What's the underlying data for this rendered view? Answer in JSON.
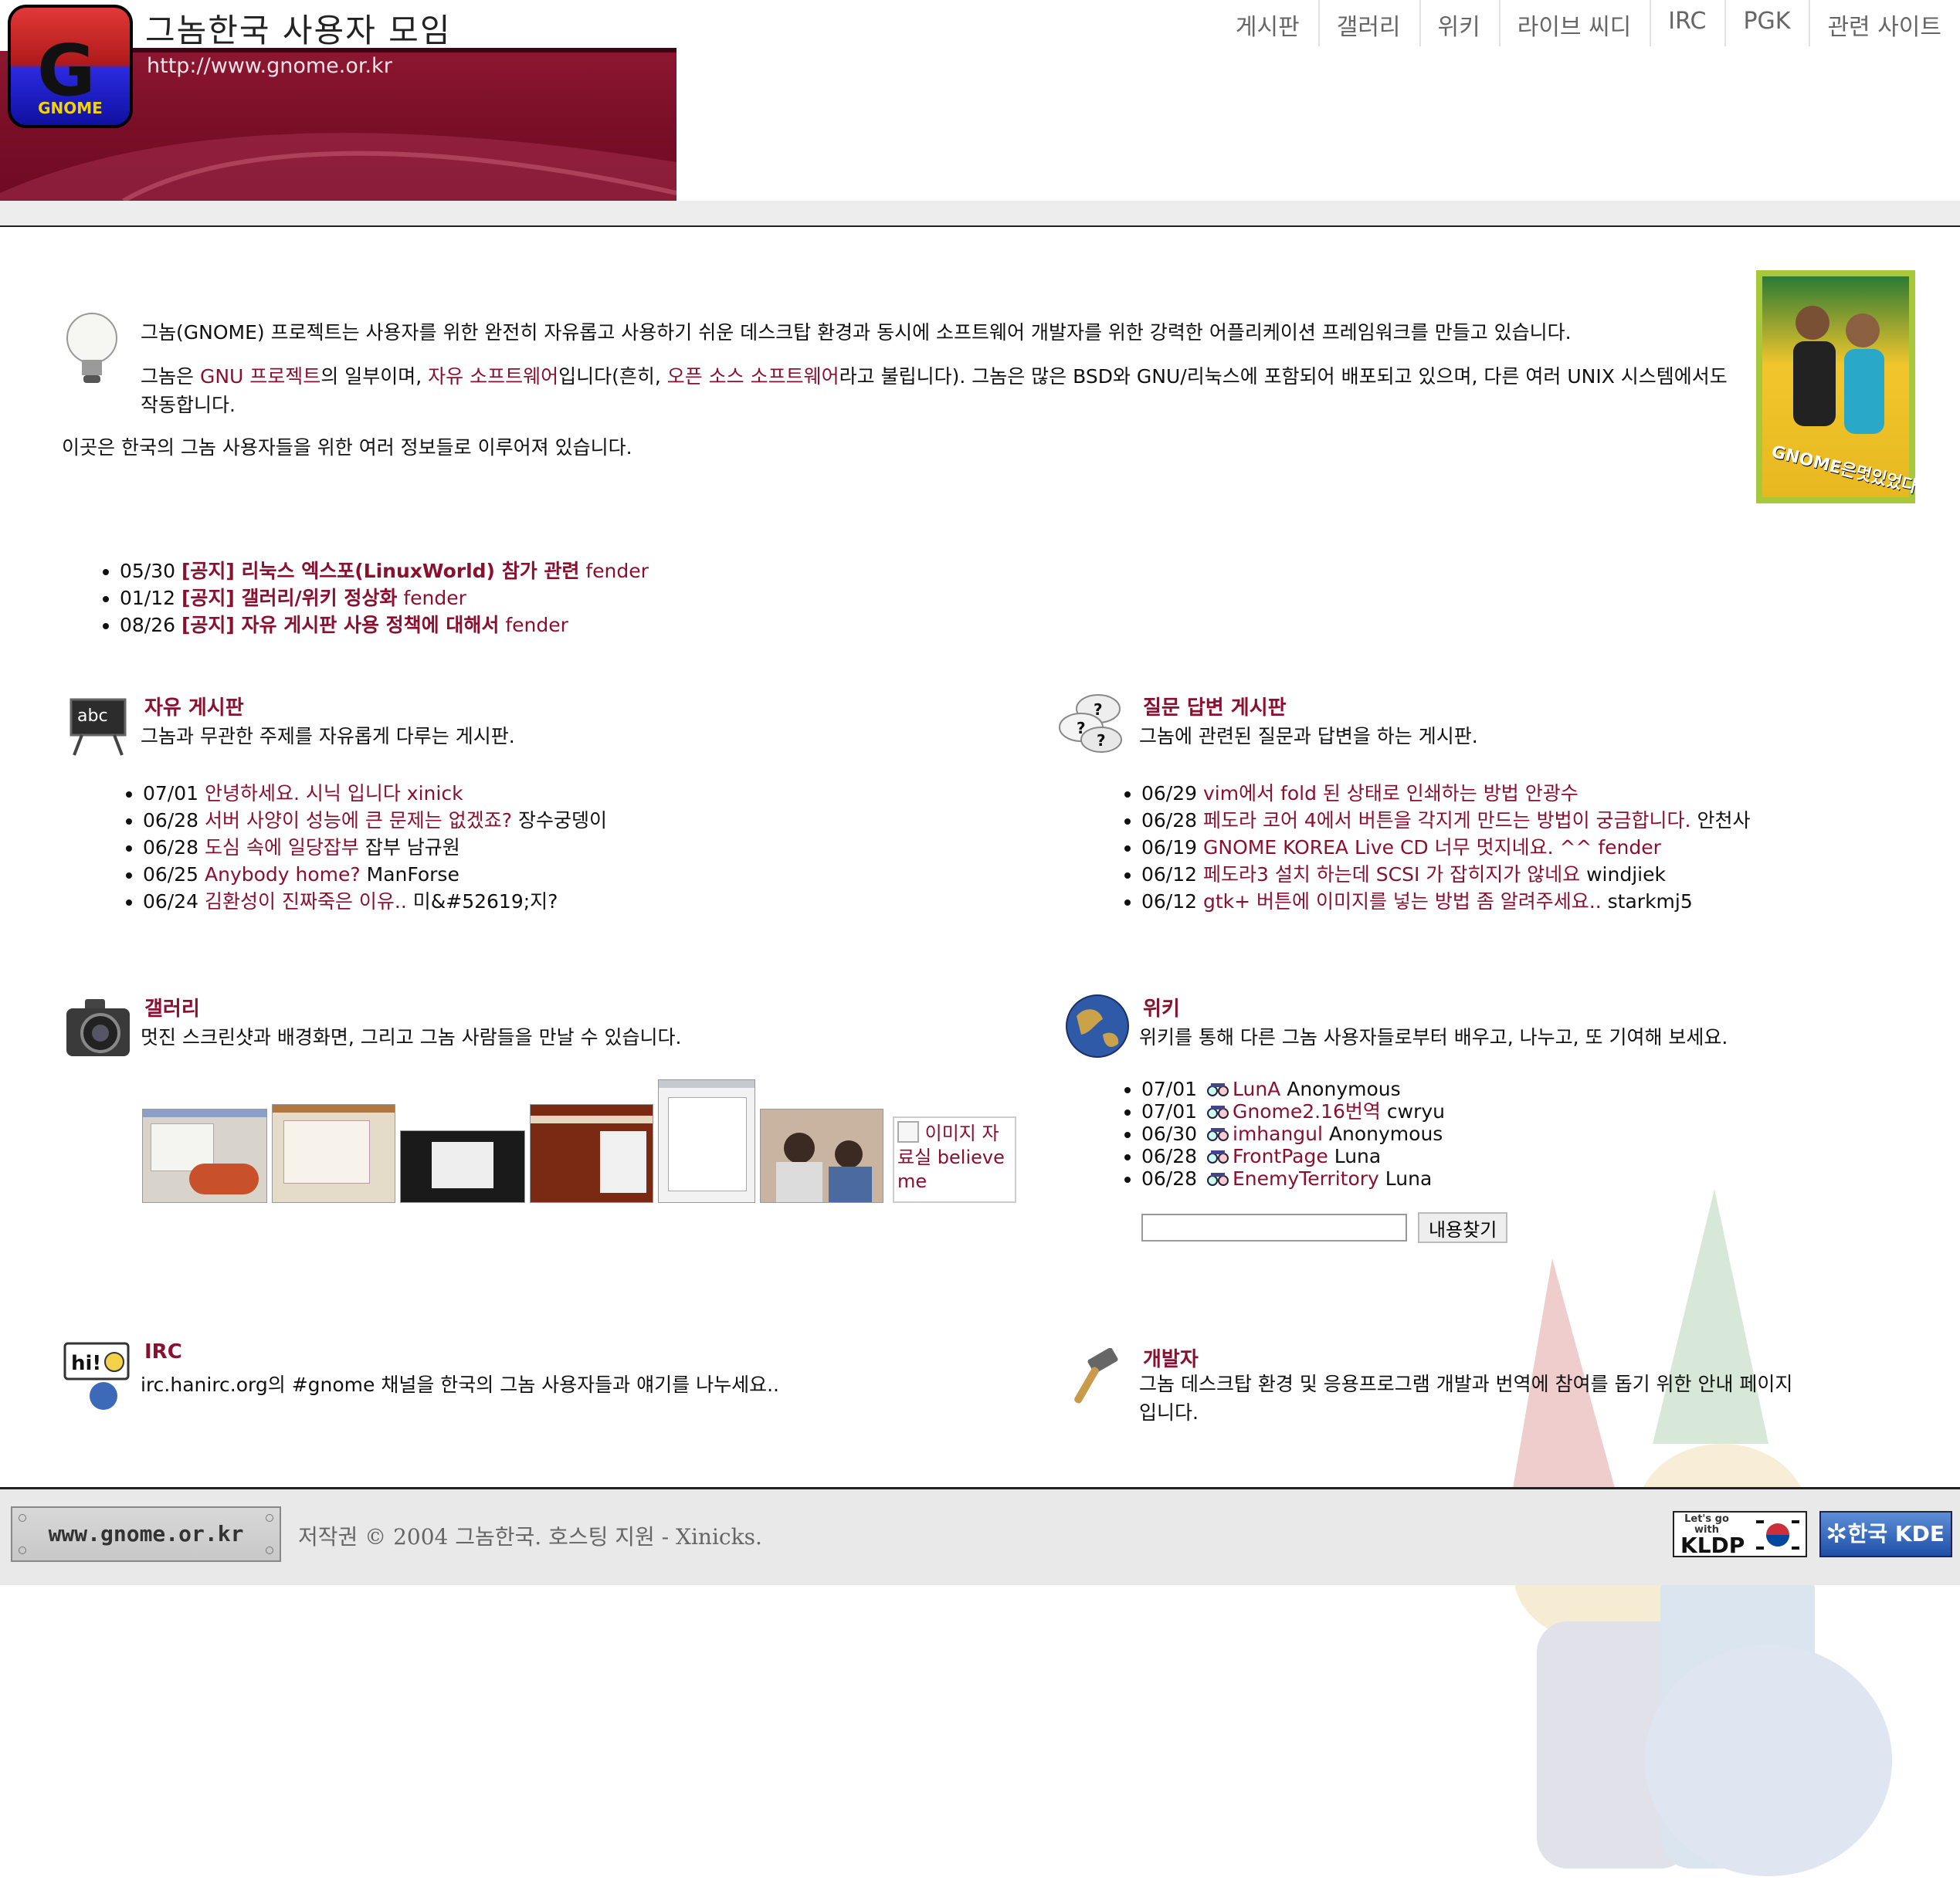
{
  "header": {
    "site_title": "그놈한국 사용자 모임",
    "site_url": "http://www.gnome.or.kr",
    "logo_text": "GNOME",
    "nav": [
      "게시판",
      "갤러리",
      "위키",
      "라이브 씨디",
      "IRC",
      "PGK",
      "관련 사이트"
    ]
  },
  "intro": {
    "p1": "그놈(GNOME) 프로젝트는 사용자를 위한 완전히 자유롭고 사용하기 쉬운 데스크탑 환경과 동시에 소프트웨어 개발자를 위한 강력한 어플리케이션 프레임워크를 만들고 있습니다.",
    "p2_a": "그놈은 ",
    "p2_link1": "GNU 프로젝트",
    "p2_b": "의 일부이며, ",
    "p2_link2": "자유 소프트웨어",
    "p2_c": "입니다(흔히, ",
    "p2_link3": "오픈 소스 소프트웨어",
    "p2_d": "라고 불립니다). 그놈은 많은 BSD와 GNU/리눅스에 포함되어 배포되고 있으며, 다른 여러 UNIX 시스템에서도 작동합니다.",
    "p3": "이곳은 한국의 그놈 사용자들을 위한 여러 정보들로 이루어져 있습니다.",
    "poster_text": "GNOME은멋있었다"
  },
  "notices": [
    {
      "date": "05/30",
      "title": "[공지] 리눅스 엑스포(LinuxWorld) 참가 관련",
      "author": "fender"
    },
    {
      "date": "01/12",
      "title": "[공지] 갤러리/위키 정상화",
      "author": "fender"
    },
    {
      "date": "08/26",
      "title": "[공지] 자유 게시판 사용 정책에 대해서",
      "author": "fender"
    }
  ],
  "free_board": {
    "title": "자유 게시판",
    "desc": "그놈과 무관한 주제를 자유롭게 다루는 게시판.",
    "icon_text": "abc",
    "items": [
      {
        "date": "07/01",
        "title": "안녕하세요. 시닉 입니다",
        "author": "xinick"
      },
      {
        "date": "06/28",
        "title": "서버 사양이 성능에 큰 문제는 없겠죠?",
        "author": "장수궁뎅이"
      },
      {
        "date": "06/28",
        "title": "도심 속에 일당잡부",
        "author": "잡부 남규원"
      },
      {
        "date": "06/25",
        "title": "Anybody home?",
        "author": "ManForse"
      },
      {
        "date": "06/24",
        "title": "김환성이 진짜죽은 이유..",
        "author": "미&#52619;지?"
      }
    ]
  },
  "qna_board": {
    "title": "질문 답변 게시판",
    "desc": "그놈에 관련된 질문과 답변을 하는 게시판.",
    "items": [
      {
        "date": "06/29",
        "title": "vim에서 fold 된 상태로 인쇄하는 방법",
        "author": "안광수"
      },
      {
        "date": "06/28",
        "title": "페도라 코어 4에서 버튼을 각지게 만드는 방법이 궁금합니다.",
        "author": "안천사"
      },
      {
        "date": "06/19",
        "title": "GNOME KOREA Live CD 너무 멋지네요. ^^",
        "author": "fender"
      },
      {
        "date": "06/12",
        "title": "페도라3 설치 하는데 SCSI 가 잡히지가 않네요",
        "author": "windjiek"
      },
      {
        "date": "06/12",
        "title": "gtk+ 버튼에 이미지를 넣는 방법 좀 알려주세요..",
        "author": "starkmj5"
      }
    ]
  },
  "gallery": {
    "title": "갤러리",
    "desc": "멋진 스크린샷과 배경화면, 그리고 그놈 사람들을 만날 수 있습니다.",
    "broken_image_alt": "이미지 자료실 believe me"
  },
  "wiki": {
    "title": "위키",
    "desc": "위키를 통해 다른 그놈 사용자들로부터 배우고, 나누고, 또 기여해 보세요.",
    "items": [
      {
        "date": "07/01",
        "page": "LunA",
        "author": "Anonymous"
      },
      {
        "date": "07/01",
        "page": "Gnome2.16번역",
        "author": "cwryu"
      },
      {
        "date": "06/30",
        "page": "imhangul",
        "author": "Anonymous"
      },
      {
        "date": "06/28",
        "page": "FrontPage",
        "author": "Luna"
      },
      {
        "date": "06/28",
        "page": "EnemyTerritory",
        "author": "Luna"
      }
    ],
    "search_button": "내용찾기",
    "search_value": ""
  },
  "irc": {
    "title": "IRC",
    "desc": "irc.hanirc.org의 #gnome 채널을 한국의 그놈 사용자들과 얘기를 나누세요..",
    "icon_text": "hi!"
  },
  "developer": {
    "title": "개발자",
    "desc": "그놈 데스크탑 환경 및 응용프로그램 개발과 번역에 참여를 돕기 위한 안내 페이지 입니다."
  },
  "footer": {
    "badge": "www.gnome.or.kr",
    "copyright": "저작권 © 2004 그놈한국. 호스팅 지원 - Xinicks.",
    "kldp_top": "Let's go with",
    "kldp": "KLDP",
    "kde": "한국 KDE"
  },
  "colors": {
    "link": "#8a1030",
    "banner": "#7b0f28",
    "footer_bg": "#e9e9e9"
  }
}
